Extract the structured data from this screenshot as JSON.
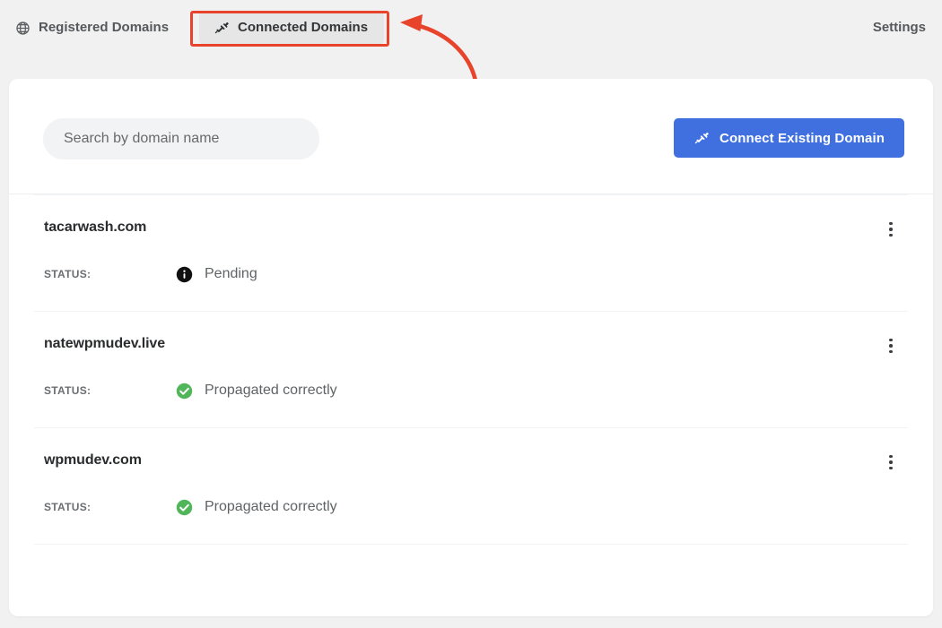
{
  "topbar": {
    "tabs": [
      {
        "label": "Registered Domains",
        "icon": "globe-icon",
        "active": false
      },
      {
        "label": "Connected Domains",
        "icon": "plug-icon",
        "active": true
      }
    ],
    "settings_label": "Settings"
  },
  "annotation": {
    "arrow_color": "#e8442c",
    "highlight_color": "#e8442c"
  },
  "toolbar": {
    "search_placeholder": "Search by domain name",
    "search_value": "",
    "connect_button_label": "Connect Existing Domain",
    "connect_button_icon": "plug-icon",
    "connect_button_color": "#4070e0"
  },
  "list": {
    "status_label": "STATUS:",
    "rows": [
      {
        "domain": "tacarwash.com",
        "status_text": "Pending",
        "status_icon": "info-icon",
        "status_color": "#111111"
      },
      {
        "domain": "natewpmudev.live",
        "status_text": "Propagated correctly",
        "status_icon": "check-circle-icon",
        "status_color": "#51b65a"
      },
      {
        "domain": "wpmudev.com",
        "status_text": "Propagated correctly",
        "status_icon": "check-circle-icon",
        "status_color": "#51b65a"
      }
    ],
    "kebab_label": "more-options"
  }
}
